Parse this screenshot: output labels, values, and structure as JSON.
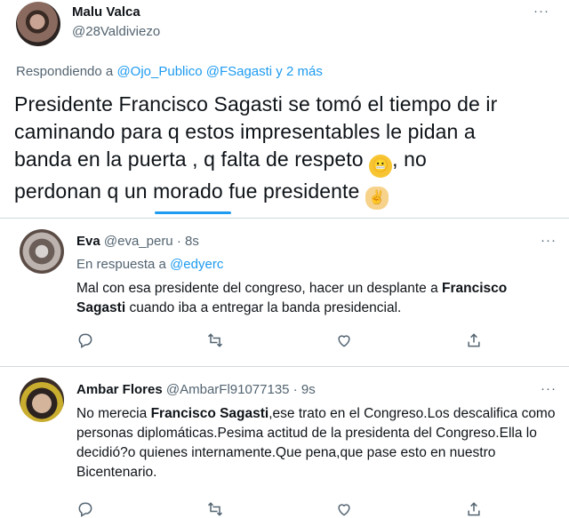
{
  "main_tweet": {
    "name": "Malu Valca",
    "handle": "@28Valdiviezo",
    "more_label": "···",
    "replying_prefix": "Respondiendo a",
    "replying_targets": "@Ojo_Publico @FSagasti y 2 más",
    "text_line1": "Presidente Francisco Sagasti se tomó el tiempo de ir",
    "text_line2": "caminando para q estos impresentables le pidan a",
    "text_line3_before": "banda en la puerta , q falta de respeto",
    "text_line3_after": ", no",
    "text_line4": "perdonan q un morado fue presidente",
    "emoji_grimace": "grimacing-face-emoji",
    "emoji_victory": "victory-hand-emoji"
  },
  "replies": [
    {
      "name": "Eva",
      "handle": "@eva_peru · 8s",
      "more_label": "···",
      "response_prefix": "En respuesta a",
      "response_target": "@edyerc",
      "body_part1": "Mal con esa presidente del congreso, hacer un desplante a ",
      "body_bold1": "Francisco Sagasti",
      "body_part2": " cuando iba a entregar la banda presidencial."
    },
    {
      "name": "Ambar Flores",
      "handle": "@AmbarFl91077135 · 9s",
      "more_label": "···",
      "body_part1": "No merecia ",
      "body_bold1": "Francisco Sagasti",
      "body_part2": ",ese trato en el Congreso.Los descalifica como personas diplomáticas.Pesima actitud de la presidenta del Congreso.Ella lo decidió?o quienes internamente.Que pena,que pase esto en nuestro Bicentenario."
    }
  ],
  "icons": [
    "reply-icon",
    "retweet-icon",
    "like-icon",
    "share-icon",
    "more-icon"
  ],
  "colors": {
    "link": "#1d9bf0",
    "secondary": "#536471",
    "divider": "#cfd9de"
  }
}
